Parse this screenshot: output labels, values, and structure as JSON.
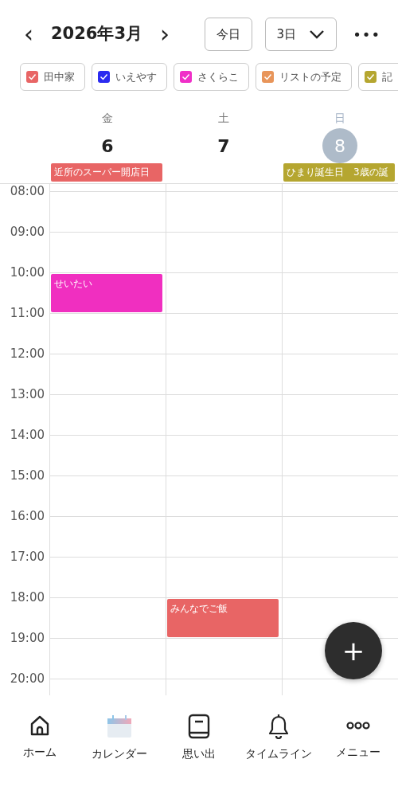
{
  "header": {
    "prev": "‹",
    "title": "2026年3月",
    "next": "›",
    "today_button": "今日",
    "view_select": "3日",
    "more": "•••"
  },
  "calendars": [
    {
      "label": "田中家",
      "checked": true,
      "color": "#e86565"
    },
    {
      "label": "いえやす",
      "checked": true,
      "color": "#2b2bf0"
    },
    {
      "label": "さくらこ",
      "checked": true,
      "color": "#f02fc8"
    },
    {
      "label": "リストの予定",
      "checked": true,
      "color": "#e8955a"
    },
    {
      "label": "記",
      "checked": true,
      "color": "#b5a630"
    }
  ],
  "days": [
    {
      "weekday": "金",
      "date": "6",
      "selected": false,
      "all_day": [
        {
          "title": "近所のスーパー開店日",
          "color": "#e86565"
        }
      ]
    },
    {
      "weekday": "土",
      "date": "7",
      "selected": false
    },
    {
      "weekday": "日",
      "date": "8",
      "selected": true,
      "all_day": [
        {
          "title": "ひまり誕生日　3歳の誕",
          "color": "#b5a630"
        }
      ]
    }
  ],
  "hours": [
    {
      "label": "08:00"
    },
    {
      "label": "09:00"
    },
    {
      "label": "10:00",
      "cells": [
        {
          "kind": "event",
          "title": "せいたい",
          "color": "#f02fc0"
        },
        {
          "kind": "empty"
        },
        {
          "kind": "empty"
        }
      ]
    },
    {
      "label": "11:00"
    },
    {
      "label": "12:00"
    },
    {
      "label": "13:00"
    },
    {
      "label": "14:00"
    },
    {
      "label": "15:00"
    },
    {
      "label": "16:00"
    },
    {
      "label": "17:00"
    },
    {
      "label": "18:00",
      "cells": [
        {
          "kind": "empty"
        },
        {
          "kind": "event",
          "title": "みんなでご飯",
          "color": "#e86565"
        },
        {
          "kind": "empty"
        }
      ]
    },
    {
      "label": "19:00"
    },
    {
      "label": "20:00"
    }
  ],
  "fab": "+",
  "nav": [
    {
      "label": "ホーム",
      "kind": "home",
      "selected": false
    },
    {
      "label": "カレンダー",
      "kind": "calendar",
      "selected": true
    },
    {
      "label": "思い出",
      "kind": "book",
      "selected": false
    },
    {
      "label": "タイムライン",
      "kind": "bell",
      "selected": false
    },
    {
      "label": "メニュー",
      "kind": "dots",
      "selected": false
    }
  ]
}
